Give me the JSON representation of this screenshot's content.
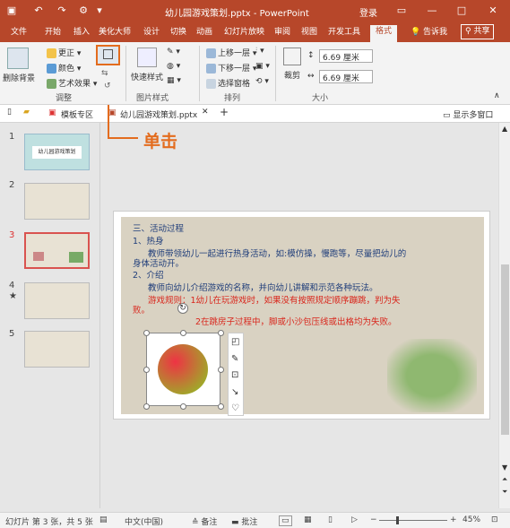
{
  "titlebar": {
    "title": "幼儿园游戏策划.pptx - PowerPoint",
    "login": "登录"
  },
  "tabs": [
    "文件",
    "开始",
    "插入",
    "美化大师",
    "设计",
    "切换",
    "动画",
    "幻灯片放映",
    "审阅",
    "视图",
    "开发工具",
    "格式"
  ],
  "tell_me": "告诉我",
  "share": "共享",
  "ribbon": {
    "remove_bg": "删除背景",
    "correct": "更正",
    "color": "颜色",
    "art_effect": "艺术效果",
    "group_adjust": "调整",
    "quick_style": "快速样式",
    "group_picture_style": "图片样式",
    "bring_forward": "上移一层",
    "send_backward": "下移一层",
    "selection_pane": "选择窗格",
    "group_arrange": "排列",
    "crop": "裁剪",
    "height_value": "6.69 厘米",
    "width_value": "6.69 厘米",
    "group_size": "大小"
  },
  "doc_tabs": {
    "template": "模板专区",
    "file": "幼儿园游戏策划.pptx",
    "show_multi": "显示多窗口"
  },
  "annotation": "单击",
  "thumbnails": [
    {
      "num": "1",
      "title": "幼儿园游戏策划"
    },
    {
      "num": "2"
    },
    {
      "num": "3"
    },
    {
      "num": "4",
      "mark": "★"
    },
    {
      "num": "5"
    }
  ],
  "slide": {
    "l1": "三、活动过程",
    "l2": "1、热身",
    "l3": "教师带领幼儿一起进行热身活动，如:模仿操，慢跑等，尽量把幼儿的",
    "l4": "身体活动开。",
    "l5": "2、介绍",
    "l6": "教师向幼儿介绍游戏的名称，并向幼儿讲解和示范各种玩法。",
    "l7": "游戏规则：1幼儿在玩游戏时，如果没有按照规定顺序蹦跳，判为失",
    "l8": "败。",
    "l9": "2在跳房子过程中，脚或小沙包压线或出格均为失败。"
  },
  "status": {
    "slide_info": "幻灯片 第 3 张，共 5 张",
    "language": "中文(中国)",
    "notes": "备注",
    "comments": "批注",
    "zoom": "45%"
  },
  "colors": {
    "accent": "#b7472a",
    "annotation": "#e36c1e"
  }
}
